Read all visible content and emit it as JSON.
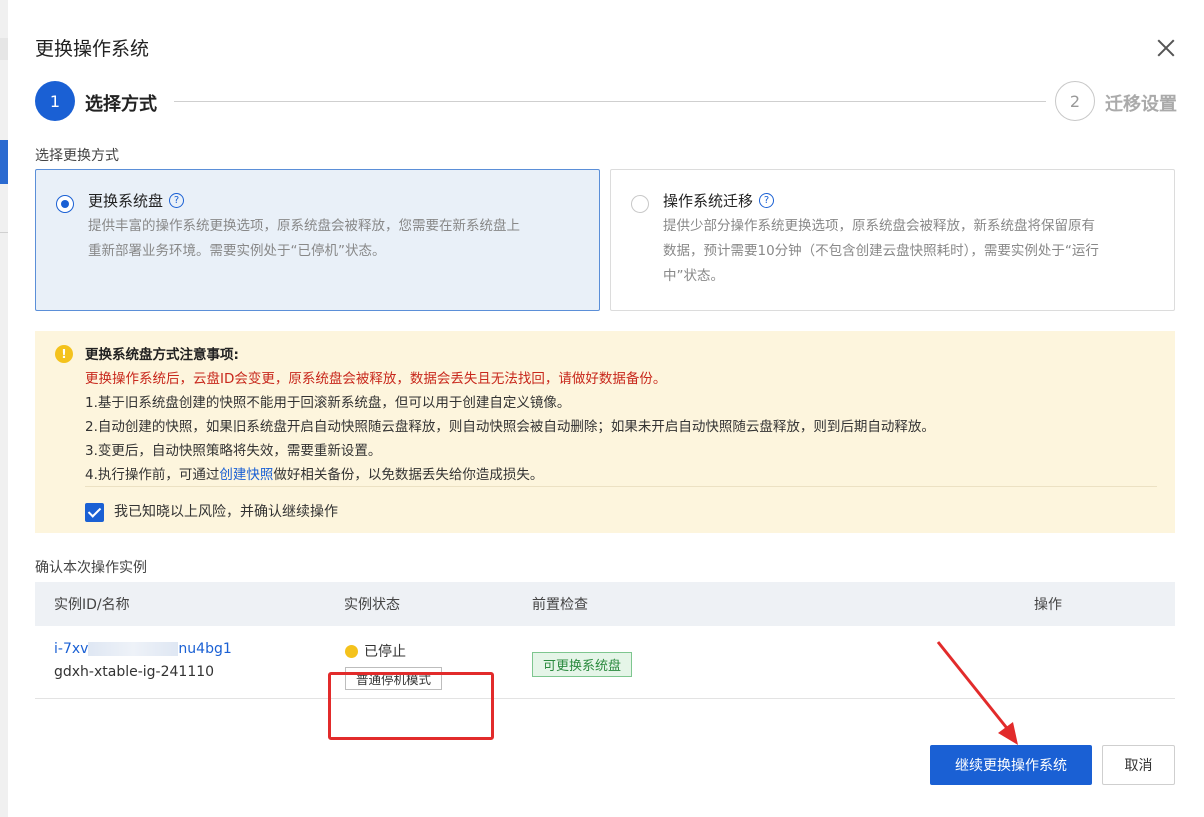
{
  "dialog": {
    "title": "更换操作系统"
  },
  "steps": [
    {
      "number": "1",
      "label": "选择方式"
    },
    {
      "number": "2",
      "label": "迁移设置"
    }
  ],
  "method_section_label": "选择更换方式",
  "options": [
    {
      "title": "更换系统盘",
      "help": "?",
      "desc_line1": "提供丰富的操作系统更换选项，原系统盘会被释放，您需要在新系统盘上",
      "desc_line2": "重新部署业务环境。需要实例处于“已停机”状态。"
    },
    {
      "title": "操作系统迁移",
      "help": "?",
      "desc_line1": "提供少部分操作系统更换选项，原系统盘会被释放，新系统盘将保留原有",
      "desc_line2": "数据，预计需要10分钟（不包含创建云盘快照耗时），需要实例处于“运行",
      "desc_line3": "中”状态。"
    }
  ],
  "notice": {
    "icon": "!",
    "title": "更换系统盘方式注意事项:",
    "warning": "更换操作系统后，云盘ID会变更，原系统盘会被释放，数据会丢失且无法找回，请做好数据备份。",
    "item1": "1.基于旧系统盘创建的快照不能用于回滚新系统盘，但可以用于创建自定义镜像。",
    "item2": "2.自动创建的快照，如果旧系统盘开启自动快照随云盘释放，则自动快照会被自动删除；如果未开启自动快照随云盘释放，则到后期自动释放。",
    "item3": "3.变更后，自动快照策略将失效，需要重新设置。",
    "item4_pre": "4.执行操作前，可通过",
    "item4_link": "创建快照",
    "item4_post": "做好相关备份，以免数据丢失给你造成损失。",
    "ack_label": "我已知晓以上风险，并确认继续操作"
  },
  "instances_section_label": "确认本次操作实例",
  "table": {
    "headers": [
      "实例ID/名称",
      "实例状态",
      "前置检查",
      "操作"
    ],
    "row": {
      "id_prefix": "i-7xv",
      "id_suffix": "nu4bg1",
      "name": "gdxh-xtable-ig-241110",
      "status": "已停止",
      "mode": "普通停机模式",
      "check": "可更换系统盘"
    }
  },
  "buttons": {
    "confirm": "继续更换操作系统",
    "cancel": "取消"
  }
}
